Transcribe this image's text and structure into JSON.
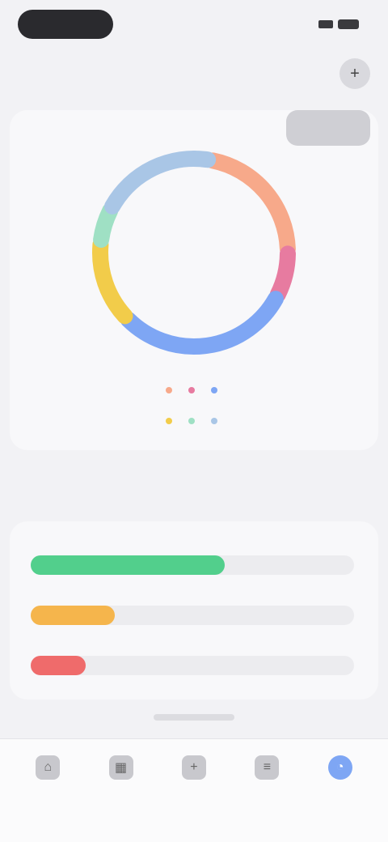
{
  "status": {
    "pill_label": ""
  },
  "header": {
    "title": "",
    "button_icon": "plus-icon",
    "button_glyph": "+"
  },
  "chart_card": {
    "title": "",
    "period_label": "",
    "center_value": ""
  },
  "chart_data": {
    "type": "pie",
    "title": "",
    "slices": [
      {
        "label": "",
        "value": 22,
        "color": "#f7a98a"
      },
      {
        "label": "",
        "value": 8,
        "color": "#e77ba0"
      },
      {
        "label": "",
        "value": 30,
        "color": "#7ea6f4"
      },
      {
        "label": "",
        "value": 14,
        "color": "#f2cc4a"
      },
      {
        "label": "",
        "value": 6,
        "color": "#9fe0c4"
      },
      {
        "label": "",
        "value": 20,
        "color": "#a9c6e6"
      }
    ]
  },
  "section": {
    "title": ""
  },
  "progress_bars": [
    {
      "label": "",
      "fraction": 0.6,
      "color": "#52cf8c"
    },
    {
      "label": "",
      "fraction": 0.26,
      "color": "#f5b54c"
    },
    {
      "label": "",
      "fraction": 0.17,
      "color": "#ef6b6b"
    }
  ],
  "tabs": [
    {
      "label": "",
      "icon": "home-icon",
      "glyph": "⌂",
      "active": false
    },
    {
      "label": "",
      "icon": "calendar-icon",
      "glyph": "▦",
      "active": false
    },
    {
      "label": "",
      "icon": "add-icon",
      "glyph": "+",
      "active": false
    },
    {
      "label": "",
      "icon": "list-icon",
      "glyph": "≡",
      "active": false
    },
    {
      "label": "",
      "icon": "chart-icon",
      "glyph": "◔",
      "active": true
    }
  ]
}
